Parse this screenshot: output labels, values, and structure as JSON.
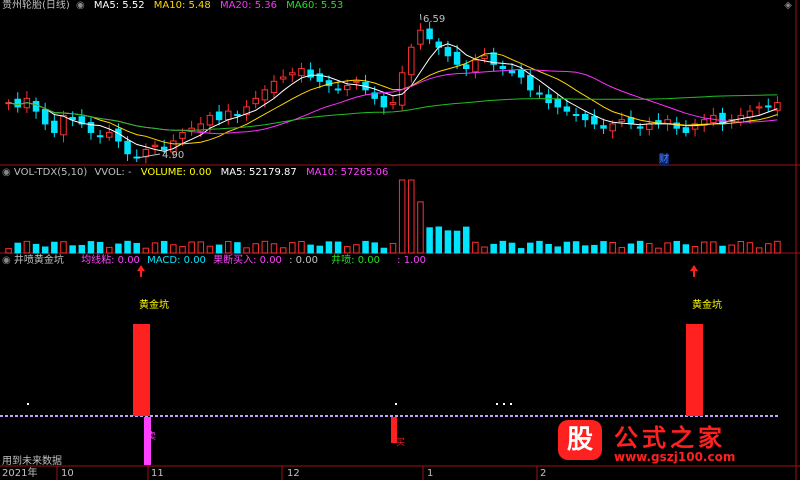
{
  "colors": {
    "up": "#ff3030",
    "down": "#00e5ff",
    "ma5": "#ffffff",
    "ma10": "#ffd700",
    "ma20": "#ff30ff",
    "ma60": "#20c020",
    "divider": "#a01010",
    "dash": "#c0a0ff",
    "text": "#c0c0c0",
    "yellow": "#ffff00",
    "green": "#20e020",
    "magenta": "#ff40ff",
    "red": "#ff2020"
  },
  "price_panel": {
    "name": "贵州轮胎(日线)",
    "ma5": "MA5: 5.52",
    "ma10": "MA10: 5.48",
    "ma20": "MA20: 5.36",
    "ma60": "MA60: 5.53",
    "high_label": "6.59",
    "low_label": "4.90",
    "event_label": "财"
  },
  "volume_panel": {
    "name": "VOL-TDX(5,10)",
    "vvol": "VVOL: -",
    "volume": "VOLUME: 0.00",
    "ma5": "MA5: 52179.87",
    "ma10": "MA10: 57265.06"
  },
  "indicator_panel": {
    "name": "井喷黄金坑",
    "item1": "均线粘: 0.00",
    "item2": "MACD: 0.00",
    "item3": "果断买入: 0.00",
    "item4": ": 0.00",
    "item5": "井喷: 0.00",
    "item6": ": 1.00",
    "signal_label": "黄金坑",
    "future_label": "用到未来数据",
    "small_char_1": "卖",
    "small_char_2": "买"
  },
  "x_axis": {
    "year": "2021年",
    "ticks": [
      "10",
      "11",
      "12",
      "1",
      "2"
    ]
  },
  "watermark": {
    "logo_char": "股",
    "name": "公式之家",
    "url": "www.gszj100.com"
  },
  "chart_data": {
    "type": "candlestick",
    "price_range": [
      4.9,
      6.59
    ],
    "volume_peak": 260000,
    "close_prices": [
      5.55,
      5.5,
      5.6,
      5.45,
      5.3,
      5.2,
      5.4,
      5.35,
      5.3,
      5.2,
      5.15,
      5.2,
      5.1,
      4.95,
      4.9,
      5.0,
      5.05,
      5.0,
      5.1,
      5.2,
      5.25,
      5.3,
      5.4,
      5.35,
      5.45,
      5.4,
      5.5,
      5.6,
      5.7,
      5.8,
      5.85,
      5.9,
      5.95,
      5.85,
      5.8,
      5.75,
      5.7,
      5.75,
      5.8,
      5.7,
      5.6,
      5.5,
      5.55,
      5.9,
      6.2,
      6.4,
      6.3,
      6.2,
      6.1,
      6.0,
      5.95,
      6.05,
      6.1,
      6.0,
      5.95,
      5.9,
      5.85,
      5.7,
      5.65,
      5.55,
      5.5,
      5.45,
      5.4,
      5.35,
      5.3,
      5.25,
      5.3,
      5.35,
      5.3,
      5.25,
      5.3,
      5.3,
      5.35,
      5.25,
      5.2,
      5.3,
      5.35,
      5.4,
      5.3,
      5.35,
      5.4,
      5.45,
      5.5,
      5.5,
      5.55
    ],
    "gold_pit_signals": [
      {
        "bar": 18,
        "value": 1.0
      },
      {
        "bar": 78,
        "value": 1.0
      }
    ]
  }
}
